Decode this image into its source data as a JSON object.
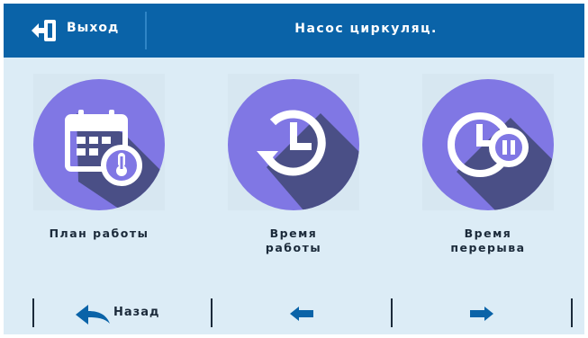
{
  "header": {
    "exit_label": "Выход",
    "title": "Насос циркуляц."
  },
  "tiles": [
    {
      "label": "План работы",
      "icon": "calendar-thermometer-icon"
    },
    {
      "label": "Время\nработы",
      "icon": "clock-history-icon"
    },
    {
      "label": "Время\nперерыва",
      "icon": "clock-pause-icon"
    }
  ],
  "nav": {
    "back_label": "Назад",
    "prev_icon": "arrow-left-icon",
    "next_icon": "arrow-right-icon"
  },
  "colors": {
    "header_bg": "#0a63a8",
    "screen_bg": "#dcecf6",
    "icon_circle": "#8077e4",
    "icon_shadow": "#4a4f86",
    "nav_icon": "#0a63a8"
  }
}
